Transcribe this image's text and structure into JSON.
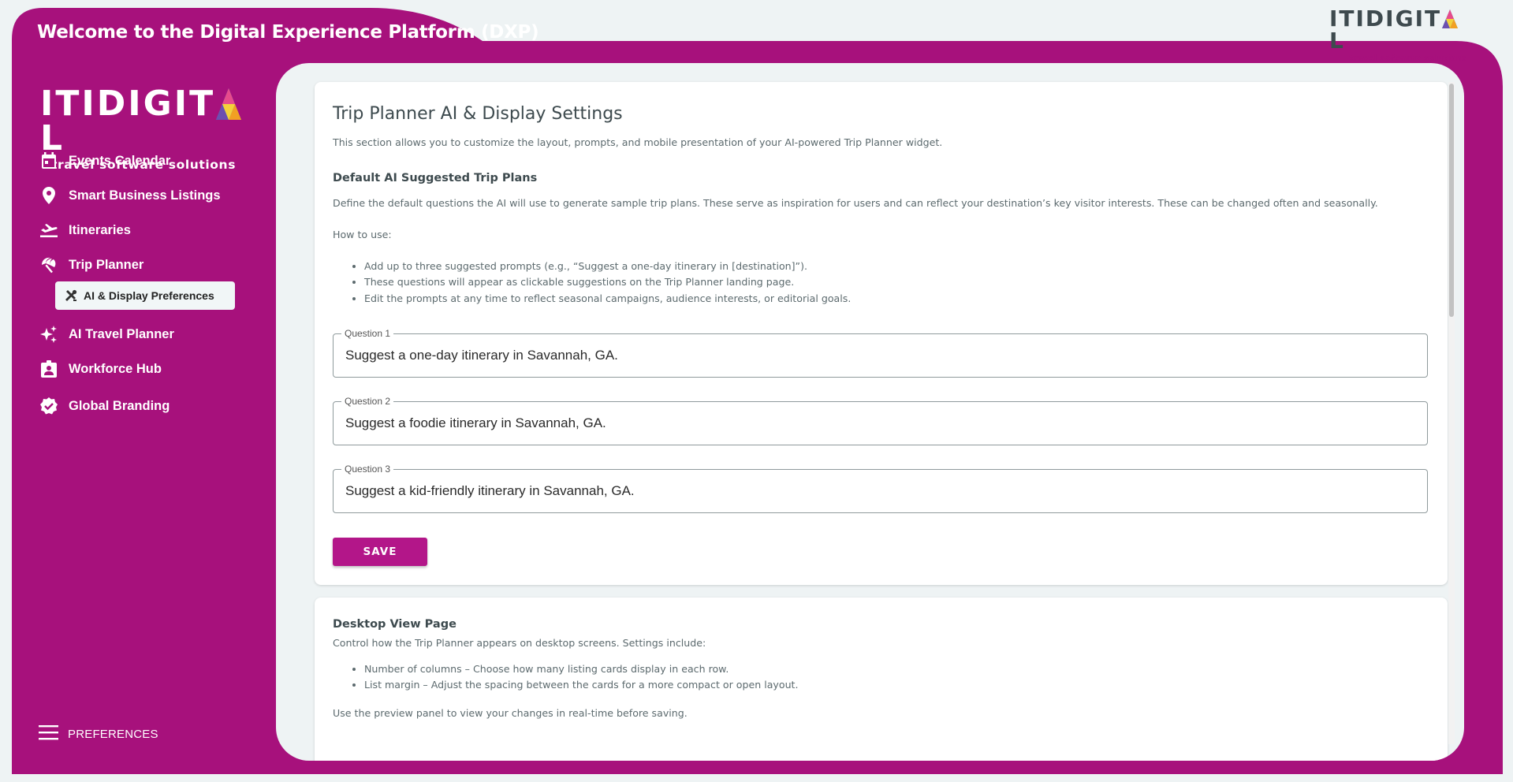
{
  "header": {
    "title": "Welcome to the Digital Experience Platform (DXP)"
  },
  "brand": {
    "logo_text_left": "ITIDIGIT",
    "logo_text_right": "L",
    "tagline": "travel software solutions",
    "primary_color": "#a7117c",
    "button_color": "#b31689"
  },
  "sidebar": {
    "items": [
      {
        "label": "Events Calendar",
        "icon": "calendar-icon"
      },
      {
        "label": "Smart Business Listings",
        "icon": "location-pin-icon"
      },
      {
        "label": "Itineraries",
        "icon": "plane-icon"
      },
      {
        "label": "Trip Planner",
        "icon": "beach-umbrella-icon"
      },
      {
        "label": "AI Travel Planner",
        "icon": "sparkle-icon"
      },
      {
        "label": "Workforce Hub",
        "icon": "badge-icon"
      },
      {
        "label": "Global Branding",
        "icon": "verified-icon"
      }
    ],
    "sub_item": {
      "label": "AI & Display Preferences",
      "icon": "tools-icon"
    },
    "preferences_label": "PREFERENCES"
  },
  "card1": {
    "title": "Trip Planner AI & Display Settings",
    "intro": "This section allows you to customize the layout, prompts, and mobile presentation of your AI-powered Trip Planner widget.",
    "section_title": "Default AI Suggested Trip Plans",
    "section_desc": "Define the default questions the AI will use to generate sample trip plans. These serve as inspiration for users and can reflect your destination’s key visitor interests. These can be changed often and seasonally.",
    "how_to": "How to use:",
    "bullets": [
      "Add up to three suggested prompts (e.g., “Suggest a one-day itinerary in [destination]”).",
      "These questions will appear as clickable suggestions on the Trip Planner landing page.",
      "Edit the prompts at any time to reflect seasonal campaigns, audience interests, or editorial goals."
    ],
    "questions": [
      {
        "label": "Question 1",
        "value": "Suggest a one-day itinerary in Savannah, GA."
      },
      {
        "label": "Question 2",
        "value": "Suggest a foodie itinerary in Savannah, GA."
      },
      {
        "label": "Question 3",
        "value": "Suggest a kid-friendly itinerary in Savannah, GA."
      }
    ],
    "save_label": "SAVE"
  },
  "card2": {
    "title": "Desktop View Page",
    "desc": "Control how the Trip Planner appears on desktop screens. Settings include:",
    "bullets": [
      "Number of columns – Choose how many listing cards display in each row.",
      "List margin – Adjust the spacing between the cards for a more compact or open layout."
    ],
    "note": "Use the preview panel to view your changes in real-time before saving."
  }
}
